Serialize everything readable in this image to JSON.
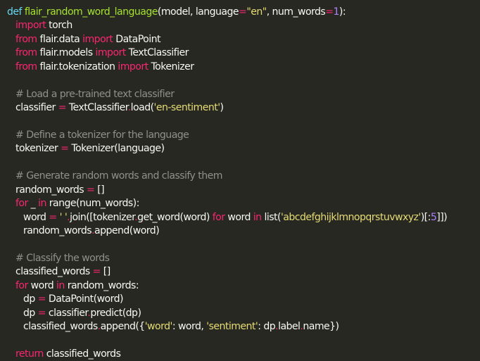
{
  "code": {
    "l1": {
      "def": "def",
      "sp1": " ",
      "fname": "flair_random_word_language",
      "p1": "(model, language",
      "eq": "=",
      "s1": "\"en\"",
      "p2": ", num_words",
      "eq2": "=",
      "n1": "1",
      "p3": "):"
    },
    "l2": {
      "kw": "import",
      "rest": " torch"
    },
    "l3": {
      "kw1": "from",
      "mid": " flair.data ",
      "kw2": "import",
      "rest": " DataPoint"
    },
    "l4": {
      "kw1": "from",
      "mid": " flair.models ",
      "kw2": "import",
      "rest": " TextClassifier"
    },
    "l5": {
      "kw1": "from",
      "mid": " flair.tokenization ",
      "kw2": "import",
      "rest": " Tokenizer"
    },
    "l7": {
      "comment": "# Load a pre-trained text classifier"
    },
    "l8": {
      "a": "classifier ",
      "eq": "=",
      "b": " TextClassifier",
      "dot": ".",
      "c": "load(",
      "s": "'en-sentiment'",
      "d": ")"
    },
    "l10": {
      "comment": "# Define a tokenizer for the language"
    },
    "l11": {
      "a": "tokenizer ",
      "eq": "=",
      "b": " Tokenizer(language)"
    },
    "l13": {
      "comment": "# Generate random words and classify them"
    },
    "l14": {
      "a": "random_words ",
      "eq": "=",
      "b": " []"
    },
    "l15": {
      "kw1": "for",
      "a": " _ ",
      "kw2": "in",
      "b": " range(num_words):"
    },
    "l16": {
      "a": "word ",
      "eq": "=",
      "s1": " ' '",
      "dot1": ".",
      "b": "join([tokenizer",
      "dot2": ".",
      "c": "get_word(word) ",
      "kw1": "for",
      "d": " word ",
      "kw2": "in",
      "e": " list(",
      "s2": "'abcdefghijklmnopqrstuvwxyz'",
      "f": ")[:",
      "n": "5",
      "g": "]])"
    },
    "l17": {
      "a": "random_words",
      "dot": ".",
      "b": "append(word)"
    },
    "l19": {
      "comment": "# Classify the words"
    },
    "l20": {
      "a": "classified_words ",
      "eq": "=",
      "b": " []"
    },
    "l21": {
      "kw1": "for",
      "a": " word ",
      "kw2": "in",
      "b": " random_words:"
    },
    "l22": {
      "a": "dp ",
      "eq": "=",
      "b": " DataPoint(word)"
    },
    "l23": {
      "a": "dp ",
      "eq": "=",
      "b": " classifier",
      "dot": ".",
      "c": "predict(dp)"
    },
    "l24": {
      "a": "classified_words",
      "dot1": ".",
      "b": "append({",
      "s1": "'word'",
      "c": ": word, ",
      "s2": "'sentiment'",
      "d": ": dp",
      "dot2": ".",
      "e": "label",
      "dot3": ".",
      "f": "name})"
    },
    "l26": {
      "kw": "return",
      "rest": " classified_words"
    }
  }
}
